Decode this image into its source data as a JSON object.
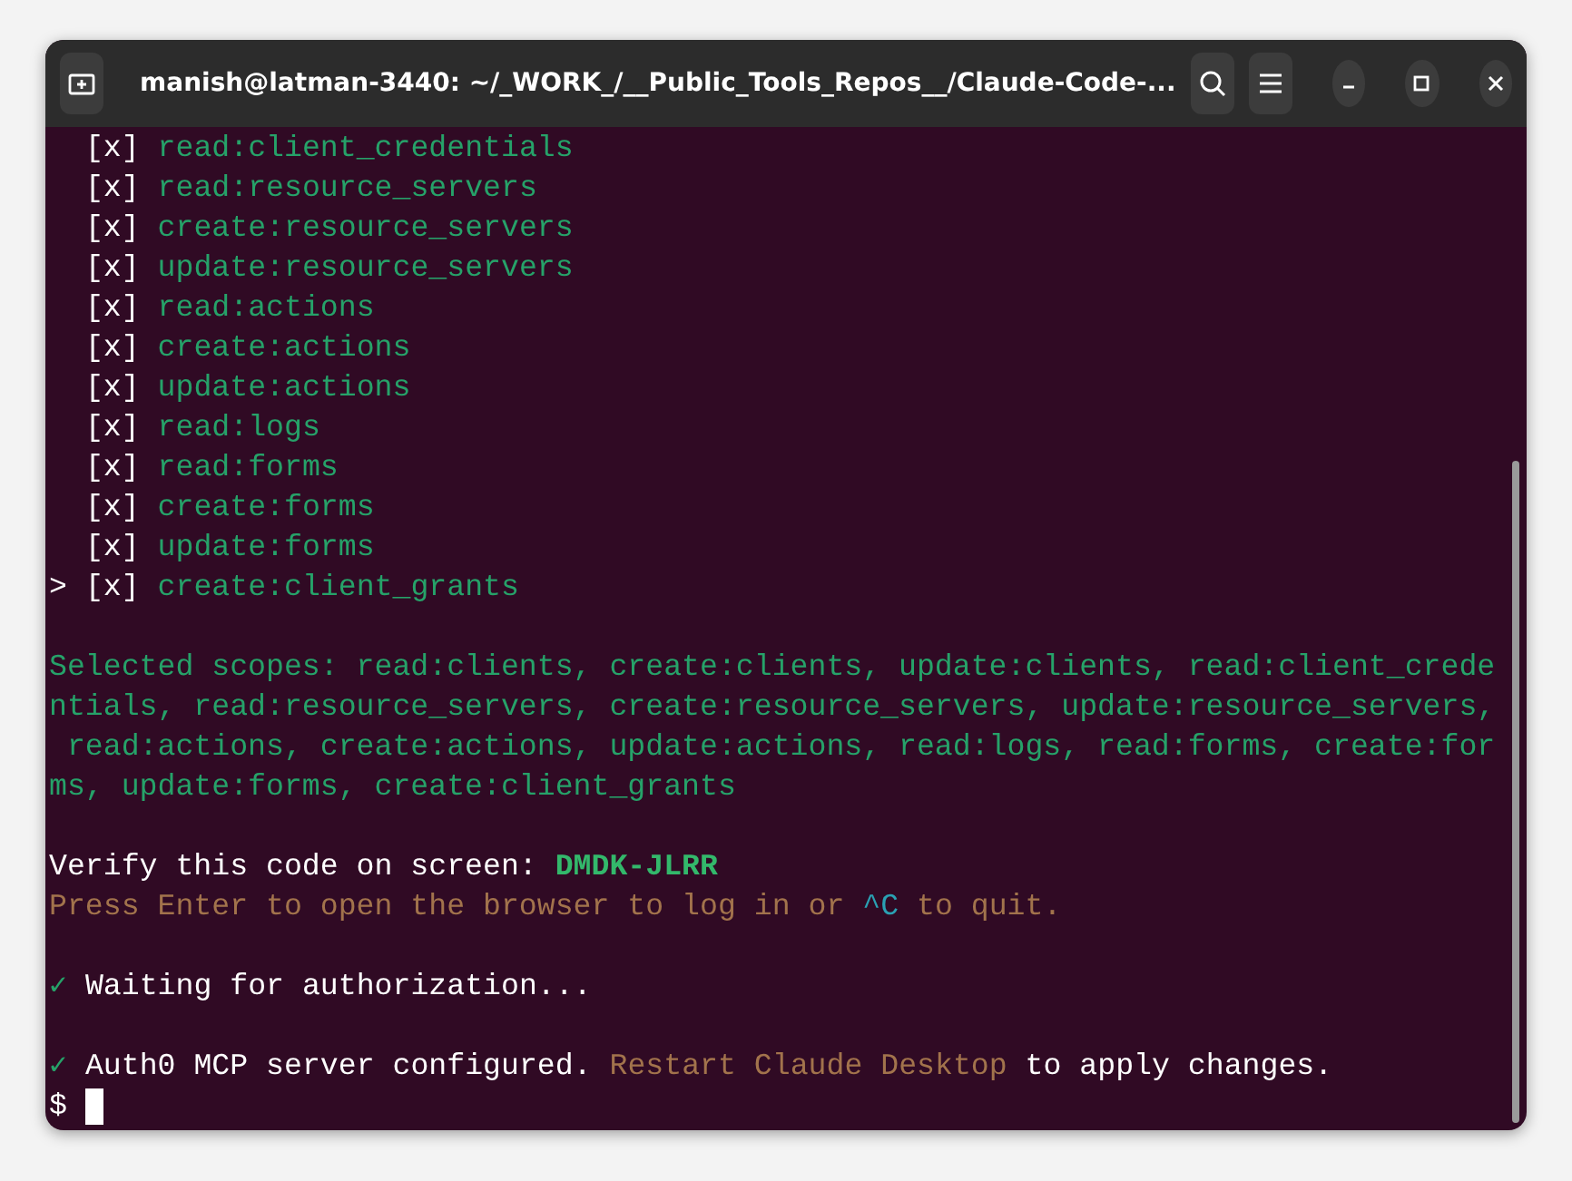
{
  "window": {
    "title": "manish@latman-3440: ~/_WORK_/__Public_Tools_Repos__/Claude-Code-..."
  },
  "terminal": {
    "scopes": [
      {
        "box": "[x]",
        "label": "read:client_credentials"
      },
      {
        "box": "[x]",
        "label": "read:resource_servers"
      },
      {
        "box": "[x]",
        "label": "create:resource_servers"
      },
      {
        "box": "[x]",
        "label": "update:resource_servers"
      },
      {
        "box": "[x]",
        "label": "read:actions"
      },
      {
        "box": "[x]",
        "label": "create:actions"
      },
      {
        "box": "[x]",
        "label": "update:actions"
      },
      {
        "box": "[x]",
        "label": "read:logs"
      },
      {
        "box": "[x]",
        "label": "read:forms"
      },
      {
        "box": "[x]",
        "label": "create:forms"
      },
      {
        "box": "[x]",
        "label": "update:forms"
      },
      {
        "pointer": ">",
        "box": "[x]",
        "label": "create:client_grants"
      }
    ],
    "selected_scopes_lines": [
      "Selected scopes: read:clients, create:clients, update:clients, read:client_crede",
      "ntials, read:resource_servers, create:resource_servers, update:resource_servers,",
      " read:actions, create:actions, update:actions, read:logs, read:forms, create:for",
      "ms, update:forms, create:client_grants"
    ],
    "verify": {
      "label": "Verify this code on screen:",
      "code": "DMDK-JLRR"
    },
    "press_line": [
      {
        "kind": "muted",
        "text": "Press Enter to open the browser to log in or "
      },
      {
        "kind": "key",
        "text": "^C"
      },
      {
        "kind": "muted",
        "text": " to quit."
      }
    ],
    "status_lines": [
      {
        "check": "✓",
        "segments": [
          {
            "kind": "plain",
            "text": "Waiting for authorization..."
          }
        ]
      },
      {
        "check": "✓",
        "segments": [
          {
            "kind": "plain",
            "text": "Auth0 MCP server configured. "
          },
          {
            "kind": "muted",
            "text": "Restart Claude Desktop"
          },
          {
            "kind": "plain",
            "text": " to apply changes."
          }
        ]
      }
    ],
    "prompt": "$"
  }
}
